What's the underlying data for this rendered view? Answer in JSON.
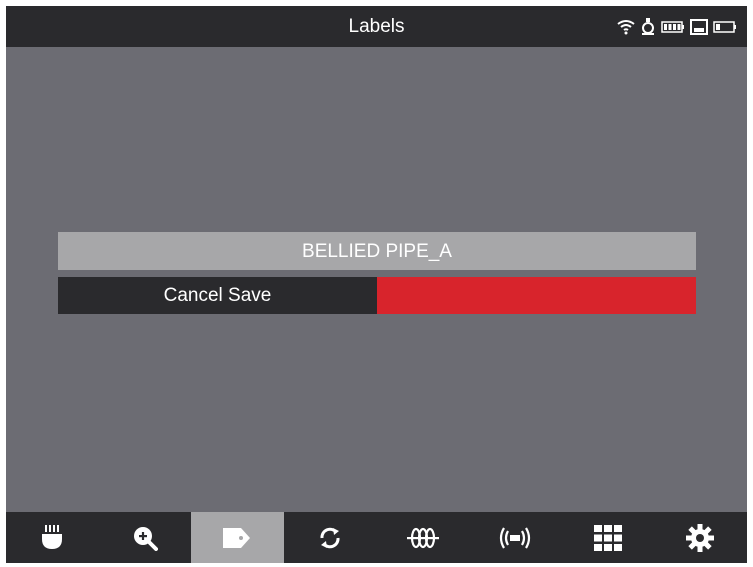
{
  "header": {
    "title": "Labels",
    "status_icons": [
      "wifi-icon",
      "sonde-icon",
      "battery-icon",
      "save-card-icon",
      "battery-outline-icon"
    ]
  },
  "label_editor": {
    "label_value": "BELLIED PIPE_A",
    "cancel_save_label": "Cancel Save",
    "accent_color": "#d8242c"
  },
  "bottom_nav": {
    "items": [
      {
        "icon": "camera-head-icon",
        "active": false
      },
      {
        "icon": "zoom-in-icon",
        "active": false
      },
      {
        "icon": "tag-icon",
        "active": true
      },
      {
        "icon": "rotate-icon",
        "active": false
      },
      {
        "icon": "coil-icon",
        "active": false
      },
      {
        "icon": "sonde-transmit-icon",
        "active": false
      },
      {
        "icon": "grid-icon",
        "active": false
      },
      {
        "icon": "settings-gear-icon",
        "active": false
      }
    ]
  }
}
